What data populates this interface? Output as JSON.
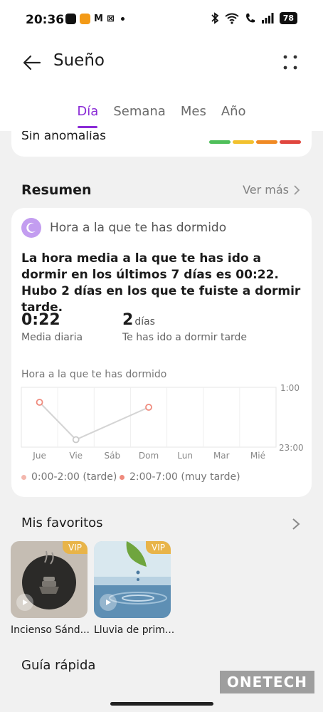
{
  "status_bar": {
    "time": "20:36",
    "battery": "78",
    "app_glyphs": [
      "M",
      "⊠"
    ]
  },
  "header": {
    "title": "Sueño"
  },
  "tabs": [
    {
      "label": "Día",
      "active": true
    },
    {
      "label": "Semana",
      "active": false
    },
    {
      "label": "Mes",
      "active": false
    },
    {
      "label": "Año",
      "active": false
    }
  ],
  "previous_card": {
    "text": "Sin anomalías",
    "severity_colors": [
      "#4fbf5a",
      "#f2c12e",
      "#f08a24",
      "#e0463e"
    ]
  },
  "summary": {
    "heading": "Resumen",
    "more_label": "Ver más",
    "card_title": "Hora a la que te has dormido",
    "description": "La hora media a la que te has ido a dormir en los últimos 7 días es 00:22. Hubo 2 días en los que te fuiste a dormir tarde.",
    "stat1_value": "0:22",
    "stat1_label": "Media diaria",
    "stat2_value": "2",
    "stat2_unit": "días",
    "stat2_label": "Te has ido a dormir tarde",
    "chart_label": "Hora a la que te has dormido",
    "legend": [
      {
        "label": "0:00-2:00 (tarde)",
        "color": "#f3b7ad"
      },
      {
        "label": "2:00-7:00 (muy tarde)",
        "color": "#ef8a7d"
      }
    ]
  },
  "chart_data": {
    "type": "line",
    "categories": [
      "Jue",
      "Vie",
      "Sáb",
      "Dom",
      "Lun",
      "Mar",
      "Mié"
    ],
    "y_ticks": [
      "1:00",
      "23:00"
    ],
    "ylim": [
      -60,
      60
    ],
    "series": [
      {
        "values": [
          30,
          -45,
          null,
          20,
          null,
          null,
          null
        ]
      }
    ],
    "grid": true
  },
  "favorites": {
    "heading": "Mis favoritos",
    "items": [
      {
        "name": "Incienso Sánd...",
        "badge": "VIP"
      },
      {
        "name": "Lluvia de prim...",
        "badge": "VIP"
      }
    ]
  },
  "quick_guide": {
    "heading": "Guía rápida"
  },
  "watermark": "ONETECH"
}
